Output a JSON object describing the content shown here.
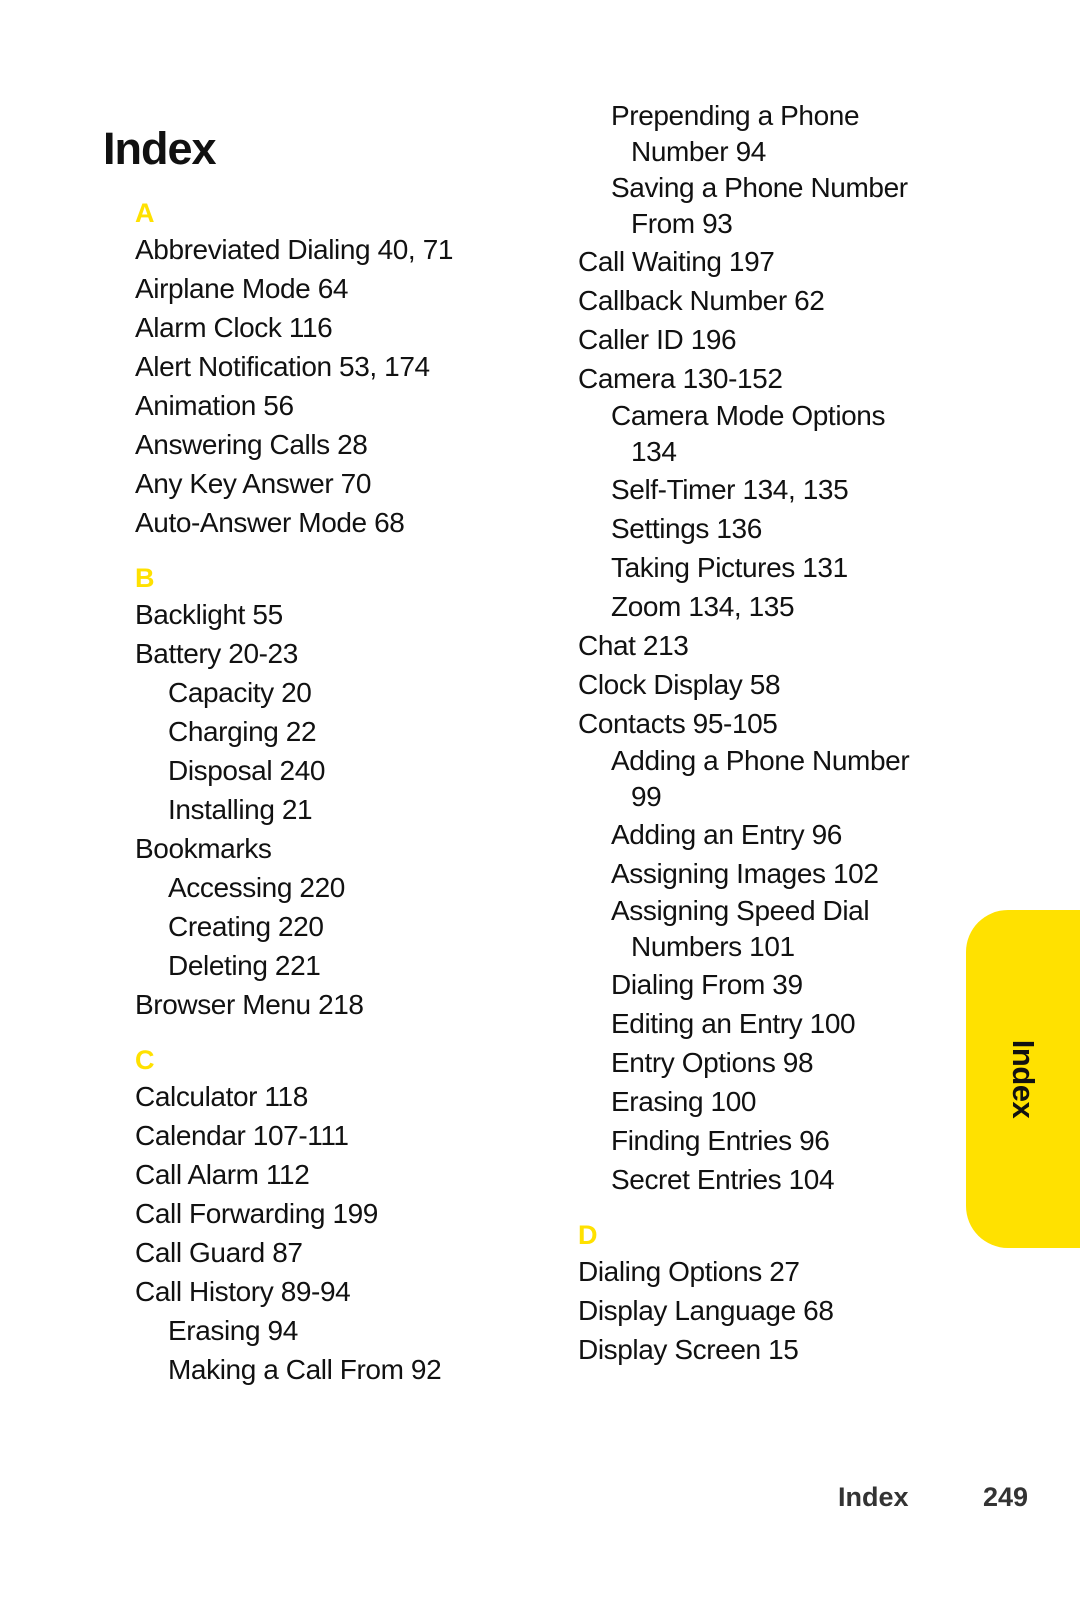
{
  "page": {
    "title": "Index",
    "accent_color": "#FFE100"
  },
  "left_column": [
    {
      "letter": "A",
      "entries": [
        {
          "text": "Abbreviated Dialing 40, 71",
          "level": 1
        },
        {
          "text": "Airplane Mode 64",
          "level": 1
        },
        {
          "text": "Alarm Clock 116",
          "level": 1
        },
        {
          "text": "Alert Notification 53, 174",
          "level": 1
        },
        {
          "text": "Animation 56",
          "level": 1
        },
        {
          "text": "Answering Calls 28",
          "level": 1
        },
        {
          "text": "Any Key Answer 70",
          "level": 1
        },
        {
          "text": "Auto-Answer Mode 68",
          "level": 1
        }
      ]
    },
    {
      "letter": "B",
      "entries": [
        {
          "text": "Backlight 55",
          "level": 1
        },
        {
          "text": "Battery 20-23",
          "level": 1
        },
        {
          "text": "Capacity 20",
          "level": 2
        },
        {
          "text": "Charging 22",
          "level": 2
        },
        {
          "text": "Disposal 240",
          "level": 2
        },
        {
          "text": "Installing 21",
          "level": 2
        },
        {
          "text": "Bookmarks",
          "level": 1
        },
        {
          "text": "Accessing 220",
          "level": 2
        },
        {
          "text": "Creating 220",
          "level": 2
        },
        {
          "text": "Deleting 221",
          "level": 2
        },
        {
          "text": "Browser Menu 218",
          "level": 1
        }
      ]
    },
    {
      "letter": "C",
      "entries": [
        {
          "text": "Calculator 118",
          "level": 1
        },
        {
          "text": "Calendar 107-111",
          "level": 1
        },
        {
          "text": "Call Alarm 112",
          "level": 1
        },
        {
          "text": "Call Forwarding 199",
          "level": 1
        },
        {
          "text": "Call Guard 87",
          "level": 1
        },
        {
          "text": "Call History 89-94",
          "level": 1
        },
        {
          "text": "Erasing 94",
          "level": 2
        },
        {
          "text": "Making a Call From 92",
          "level": 2
        }
      ]
    }
  ],
  "right_column": [
    {
      "letter": "",
      "entries": [
        {
          "text": "Prepending a Phone",
          "cont": "Number 94",
          "level": 2
        },
        {
          "text": "Saving a Phone Number",
          "cont": "From 93",
          "level": 2
        },
        {
          "text": "Call Waiting 197",
          "level": 1
        },
        {
          "text": "Callback Number 62",
          "level": 1
        },
        {
          "text": "Caller ID 196",
          "level": 1
        },
        {
          "text": "Camera 130-152",
          "level": 1
        },
        {
          "text": "Camera Mode Options",
          "cont": "134",
          "level": 2
        },
        {
          "text": "Self-Timer 134, 135",
          "level": 2
        },
        {
          "text": "Settings 136",
          "level": 2
        },
        {
          "text": "Taking Pictures 131",
          "level": 2
        },
        {
          "text": "Zoom 134, 135",
          "level": 2
        },
        {
          "text": "Chat 213",
          "level": 1
        },
        {
          "text": "Clock Display 58",
          "level": 1
        },
        {
          "text": "Contacts 95-105",
          "level": 1
        },
        {
          "text": "Adding a Phone Number",
          "cont": "99",
          "level": 2
        },
        {
          "text": "Adding an Entry 96",
          "level": 2
        },
        {
          "text": "Assigning Images 102",
          "level": 2
        },
        {
          "text": "Assigning Speed Dial",
          "cont": "Numbers 101",
          "level": 2
        },
        {
          "text": "Dialing From 39",
          "level": 2
        },
        {
          "text": "Editing an Entry 100",
          "level": 2
        },
        {
          "text": "Entry Options 98",
          "level": 2
        },
        {
          "text": "Erasing 100",
          "level": 2
        },
        {
          "text": "Finding Entries 96",
          "level": 2
        },
        {
          "text": "Secret Entries 104",
          "level": 2
        }
      ]
    },
    {
      "letter": "D",
      "entries": [
        {
          "text": "Dialing Options 27",
          "level": 1
        },
        {
          "text": "Display Language 68",
          "level": 1
        },
        {
          "text": "Display Screen 15",
          "level": 1
        }
      ]
    }
  ],
  "side_tab": {
    "label": "Index"
  },
  "footer": {
    "section": "Index",
    "page_number": "249"
  }
}
